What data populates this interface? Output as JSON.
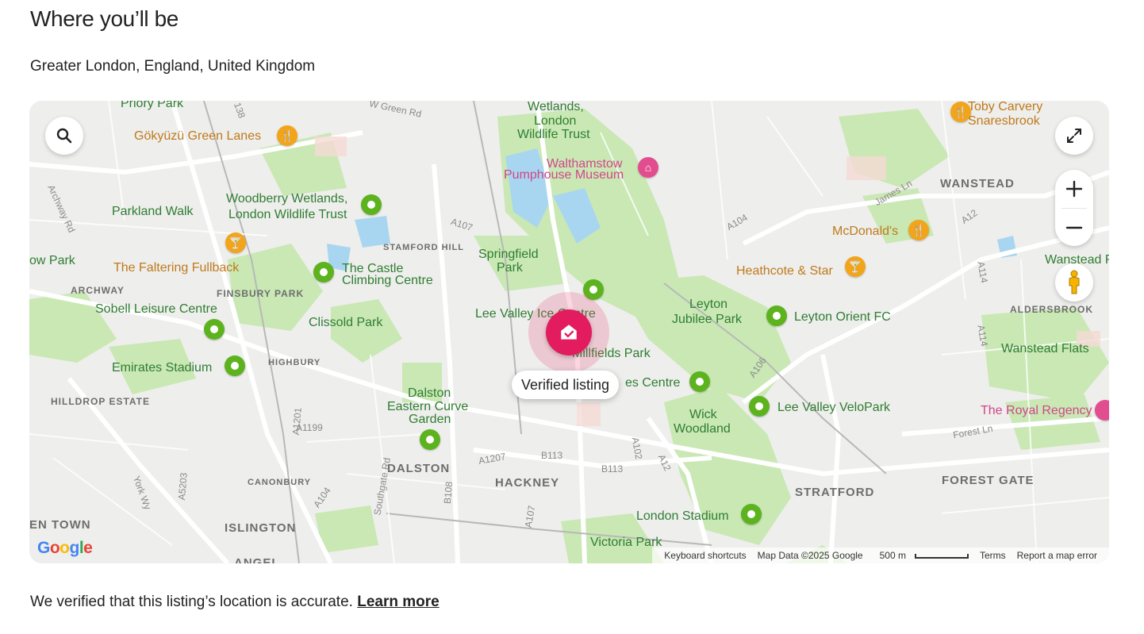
{
  "section": {
    "title": "Where you’ll be",
    "location": "Greater London, England, United Kingdom"
  },
  "map": {
    "marker_label": "Verified listing",
    "labels": {
      "priory_park": "Priory Park",
      "gokyuzu": "Gökyüzü Green Lanes",
      "green_rd": "W Green Rd",
      "wetlands": "Wetlands,",
      "wetlands2": "London",
      "wetlands3": "Wildlife Trust",
      "walthamstow": "Walthamstow",
      "pumphouse": "Pumphouse Museum",
      "toby": "Toby Carvery",
      "toby2": "Snaresbrook",
      "wanstead": "WANSTEAD",
      "parkland": "Parkland Walk",
      "woodberry": "Woodberry Wetlands,",
      "woodberry2": "London Wildlife Trust",
      "stamford": "STAMFORD HILL",
      "mcdonalds": "McDonald's",
      "jamesln": "James Ln",
      "ow_park": "ow Park",
      "faltering": "The Faltering Fullback",
      "castle": "The Castle",
      "castle2": "Climbing Centre",
      "springfield": "Springfield",
      "springfield2": "Park",
      "heathcote": "Heathcote & Star",
      "wanstead_pa": "Wanstead Pa",
      "archway": "ARCHWAY",
      "finsbury": "FINSBURY PARK",
      "sobell": "Sobell Leisure Centre",
      "clissold": "Clissold Park",
      "leevalley_ice": "Lee Valley Ice Centre",
      "leyton_jubilee": "Leyton",
      "leyton_jubilee2": "Jubilee Park",
      "leyton_orient": "Leyton Orient FC",
      "aldersbrook": "ALDERSBROOK",
      "emirates": "Emirates Stadium",
      "highbury": "HIGHBURY",
      "millfields": "Millfields Park",
      "es_centre": "es Centre",
      "wanstead_flats": "Wanstead Flats",
      "hilldrop": "HILLDROP ESTATE",
      "dalston_garden": "Dalston",
      "dalston_garden2": "Eastern Curve",
      "dalston_garden3": "Garden",
      "wick": "Wick",
      "wick2": "Woodland",
      "velopark": "Lee Valley VeloPark",
      "royal_regency": "The Royal Regency",
      "dalston": "DALSTON",
      "hackney": "HACKNEY",
      "stratford": "STRATFORD",
      "forest_gate": "FOREST GATE",
      "canonbury": "CANONBURY",
      "london_stadium": "London Stadium",
      "en_town": "EN TOWN",
      "islington": "ISLINGTON",
      "victoria_park": "Victoria Park",
      "angel": "ANGEL",
      "a107": "A107",
      "a104": "A104",
      "a12": "A12",
      "a114": "A114",
      "a106": "A106",
      "a1207": "A1207",
      "b113": "B113",
      "b113b": "B113",
      "a102": "A102",
      "a1199": "A1199",
      "a1201": "A1201",
      "a5203": "A5203",
      "a104b": "A104",
      "b108": "B108",
      "southgate": "Southgate Rd",
      "a107b": "A107",
      "forestln": "Forest Ln",
      "york": "York Wy",
      "archway_rd": "Archway Rd",
      "a12b": "A12",
      "a114b": "A114",
      "b138": "138"
    },
    "attribution": {
      "google": "Google",
      "shortcuts": "Keyboard shortcuts",
      "data": "Map Data ©2025 Google",
      "scale": "500 m",
      "terms": "Terms",
      "report": "Report a map error"
    }
  },
  "footer": {
    "note": "We verified that this listing’s location is accurate.",
    "learn_more": "Learn more"
  },
  "colors": {
    "listing_marker": "#e31c5f",
    "park_pin": "#5cb31e",
    "food_pin": "#f2a51a",
    "museum_pin": "#e24d8f"
  },
  "icons": {
    "search": "search-icon",
    "fullscreen": "fullscreen-icon",
    "zoom_in": "plus-icon",
    "zoom_out": "minus-icon",
    "street_view": "pegman-icon",
    "listing": "home-check-icon"
  }
}
